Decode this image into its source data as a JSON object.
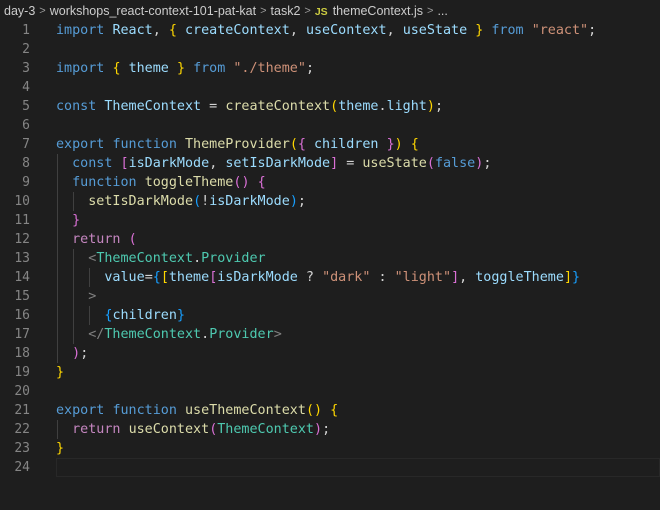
{
  "breadcrumb": [
    {
      "label": "day-3",
      "kind": "folder"
    },
    {
      "label": "workshops_react-context-101-pat-kat",
      "kind": "folder"
    },
    {
      "label": "task2",
      "kind": "folder"
    },
    {
      "label": "themeContext.js",
      "kind": "file",
      "badge": "JS"
    },
    {
      "label": "...",
      "kind": "more"
    }
  ],
  "breadcrumb_separator": ">",
  "editor": {
    "file_language": "javascript",
    "lines": [
      {
        "n": "1",
        "tokens": [
          [
            "kw",
            "import"
          ],
          [
            "t",
            " "
          ],
          [
            "var",
            "React"
          ],
          [
            "t",
            ", "
          ],
          [
            "br1",
            "{"
          ],
          [
            "t",
            " "
          ],
          [
            "var",
            "createContext"
          ],
          [
            "t",
            ", "
          ],
          [
            "var",
            "useContext"
          ],
          [
            "t",
            ", "
          ],
          [
            "var",
            "useState"
          ],
          [
            "t",
            " "
          ],
          [
            "br1",
            "}"
          ],
          [
            "t",
            " "
          ],
          [
            "kw",
            "from"
          ],
          [
            "t",
            " "
          ],
          [
            "str",
            "\"react\""
          ],
          [
            "t",
            ";"
          ]
        ]
      },
      {
        "n": "2",
        "tokens": []
      },
      {
        "n": "3",
        "tokens": [
          [
            "kw",
            "import"
          ],
          [
            "t",
            " "
          ],
          [
            "br1",
            "{"
          ],
          [
            "t",
            " "
          ],
          [
            "var",
            "theme"
          ],
          [
            "t",
            " "
          ],
          [
            "br1",
            "}"
          ],
          [
            "t",
            " "
          ],
          [
            "kw",
            "from"
          ],
          [
            "t",
            " "
          ],
          [
            "str",
            "\"./theme\""
          ],
          [
            "t",
            ";"
          ]
        ]
      },
      {
        "n": "4",
        "tokens": []
      },
      {
        "n": "5",
        "tokens": [
          [
            "kw",
            "const"
          ],
          [
            "t",
            " "
          ],
          [
            "var",
            "ThemeContext"
          ],
          [
            "t",
            " = "
          ],
          [
            "fn",
            "createContext"
          ],
          [
            "br1",
            "("
          ],
          [
            "var",
            "theme"
          ],
          [
            "t",
            "."
          ],
          [
            "var",
            "light"
          ],
          [
            "br1",
            ")"
          ],
          [
            "t",
            ";"
          ]
        ]
      },
      {
        "n": "6",
        "tokens": []
      },
      {
        "n": "7",
        "tokens": [
          [
            "kw",
            "export"
          ],
          [
            "t",
            " "
          ],
          [
            "kw",
            "function"
          ],
          [
            "t",
            " "
          ],
          [
            "fn",
            "ThemeProvider"
          ],
          [
            "br1",
            "("
          ],
          [
            "br2",
            "{"
          ],
          [
            "t",
            " "
          ],
          [
            "var",
            "children"
          ],
          [
            "t",
            " "
          ],
          [
            "br2",
            "}"
          ],
          [
            "br1",
            ")"
          ],
          [
            "t",
            " "
          ],
          [
            "br1",
            "{"
          ]
        ]
      },
      {
        "n": "8",
        "tokens": [
          [
            "t",
            "  "
          ],
          [
            "kw",
            "const"
          ],
          [
            "t",
            " "
          ],
          [
            "br2",
            "["
          ],
          [
            "var",
            "isDarkMode"
          ],
          [
            "t",
            ", "
          ],
          [
            "var",
            "setIsDarkMode"
          ],
          [
            "br2",
            "]"
          ],
          [
            "t",
            " = "
          ],
          [
            "fn",
            "useState"
          ],
          [
            "br2",
            "("
          ],
          [
            "kw",
            "false"
          ],
          [
            "br2",
            ")"
          ],
          [
            "t",
            ";"
          ]
        ]
      },
      {
        "n": "9",
        "tokens": [
          [
            "t",
            "  "
          ],
          [
            "kw",
            "function"
          ],
          [
            "t",
            " "
          ],
          [
            "fn",
            "toggleTheme"
          ],
          [
            "br2",
            "("
          ],
          [
            "br2",
            ")"
          ],
          [
            "t",
            " "
          ],
          [
            "br2",
            "{"
          ]
        ]
      },
      {
        "n": "10",
        "tokens": [
          [
            "t",
            "    "
          ],
          [
            "fn",
            "setIsDarkMode"
          ],
          [
            "br3",
            "("
          ],
          [
            "t",
            "!"
          ],
          [
            "var",
            "isDarkMode"
          ],
          [
            "br3",
            ")"
          ],
          [
            "t",
            ";"
          ]
        ]
      },
      {
        "n": "11",
        "tokens": [
          [
            "t",
            "  "
          ],
          [
            "br2",
            "}"
          ]
        ]
      },
      {
        "n": "12",
        "tokens": [
          [
            "t",
            "  "
          ],
          [
            "ctrl",
            "return"
          ],
          [
            "t",
            " "
          ],
          [
            "br2",
            "("
          ]
        ]
      },
      {
        "n": "13",
        "tokens": [
          [
            "t",
            "    "
          ],
          [
            "tag",
            "<"
          ],
          [
            "cls",
            "ThemeContext"
          ],
          [
            "t",
            "."
          ],
          [
            "cls",
            "Provider"
          ]
        ]
      },
      {
        "n": "14",
        "tokens": [
          [
            "t",
            "      "
          ],
          [
            "var",
            "value"
          ],
          [
            "t",
            "="
          ],
          [
            "br3",
            "{"
          ],
          [
            "br1",
            "["
          ],
          [
            "var",
            "theme"
          ],
          [
            "br2",
            "["
          ],
          [
            "var",
            "isDarkMode"
          ],
          [
            "t",
            " ? "
          ],
          [
            "str",
            "\"dark\""
          ],
          [
            "t",
            " : "
          ],
          [
            "str",
            "\"light\""
          ],
          [
            "br2",
            "]"
          ],
          [
            "t",
            ", "
          ],
          [
            "var",
            "toggleTheme"
          ],
          [
            "br1",
            "]"
          ],
          [
            "br3",
            "}"
          ]
        ]
      },
      {
        "n": "15",
        "tokens": [
          [
            "t",
            "    "
          ],
          [
            "tag",
            ">"
          ]
        ]
      },
      {
        "n": "16",
        "tokens": [
          [
            "t",
            "      "
          ],
          [
            "br3",
            "{"
          ],
          [
            "var",
            "children"
          ],
          [
            "br3",
            "}"
          ]
        ]
      },
      {
        "n": "17",
        "tokens": [
          [
            "t",
            "    "
          ],
          [
            "tag",
            "</"
          ],
          [
            "cls",
            "ThemeContext"
          ],
          [
            "t",
            "."
          ],
          [
            "cls",
            "Provider"
          ],
          [
            "tag",
            ">"
          ]
        ]
      },
      {
        "n": "18",
        "tokens": [
          [
            "t",
            "  "
          ],
          [
            "br2",
            ")"
          ],
          [
            "t",
            ";"
          ]
        ]
      },
      {
        "n": "19",
        "tokens": [
          [
            "br1",
            "}"
          ]
        ]
      },
      {
        "n": "20",
        "tokens": []
      },
      {
        "n": "21",
        "tokens": [
          [
            "kw",
            "export"
          ],
          [
            "t",
            " "
          ],
          [
            "kw",
            "function"
          ],
          [
            "t",
            " "
          ],
          [
            "fn",
            "useThemeContext"
          ],
          [
            "br1",
            "("
          ],
          [
            "br1",
            ")"
          ],
          [
            "t",
            " "
          ],
          [
            "br1",
            "{"
          ]
        ]
      },
      {
        "n": "22",
        "tokens": [
          [
            "t",
            "  "
          ],
          [
            "ctrl",
            "return"
          ],
          [
            "t",
            " "
          ],
          [
            "fn",
            "useContext"
          ],
          [
            "br2",
            "("
          ],
          [
            "cls",
            "ThemeContext"
          ],
          [
            "br2",
            ")"
          ],
          [
            "t",
            ";"
          ]
        ]
      },
      {
        "n": "23",
        "tokens": [
          [
            "br1",
            "}"
          ]
        ]
      },
      {
        "n": "24",
        "tokens": [],
        "current": true
      }
    ]
  },
  "colors": {
    "background": "#1e1e1e",
    "line_number": "#858585",
    "keyword": "#569cd6",
    "control": "#c586c0",
    "function": "#dcdcaa",
    "variable": "#9cdcfe",
    "string": "#ce9178",
    "class": "#4ec9b0"
  }
}
